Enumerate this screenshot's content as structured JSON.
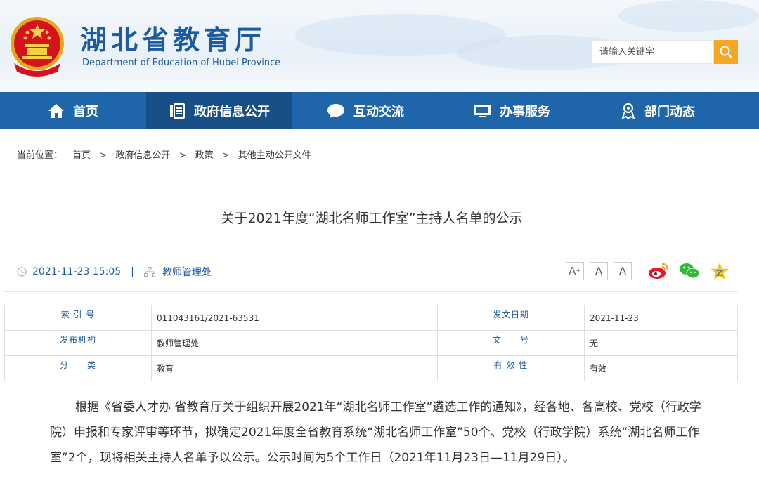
{
  "site": {
    "title": "湖北省教育厅",
    "subtitle": "Department of Education of Hubei Province"
  },
  "search": {
    "placeholder": "请输入关键字"
  },
  "nav": {
    "items": [
      {
        "label": "首页",
        "icon": "home-icon"
      },
      {
        "label": "政府信息公开",
        "icon": "document-list-icon",
        "active": true
      },
      {
        "label": "互动交流",
        "icon": "chat-bubble-icon"
      },
      {
        "label": "办事服务",
        "icon": "monitor-icon"
      },
      {
        "label": "部门动态",
        "icon": "award-person-icon"
      }
    ]
  },
  "breadcrumb": {
    "prefix": "当前位置：",
    "items": [
      "首页",
      "政府信息公开",
      "政策",
      "其他主动公开文件"
    ],
    "separator": ">"
  },
  "article": {
    "title": "关于2021年度“湖北名师工作室”主持人名单的公示",
    "datetime": "2021-11-23 15:05",
    "divider": "|",
    "department": "教师管理处",
    "paragraph": "根据《省委人才办 省教育厅关于组织开展2021年“湖北名师工作室”遴选工作的通知》，经各地、各高校、党校（行政学院）申报和专家评审等环节，拟确定2021年度全省教育系统“湖北名师工作室”50个、党校（行政学院）系统“湖北名师工作室”2个，现将相关主持人名单予以公示。公示时间为5个工作日（2021年11月23日—11月29日）。"
  },
  "font_buttons": [
    "A+",
    "A",
    "A-"
  ],
  "share": {
    "weibo_icon": "weibo-icon",
    "wechat_icon": "wechat-icon",
    "qzone_icon": "qzone-star-icon"
  },
  "info_table": {
    "rows": [
      {
        "k1": "索 引 号",
        "v1": "011043161/2021-63531",
        "k2": "发文日期",
        "v2": "2021-11-23"
      },
      {
        "k1": "发布机构",
        "v1": "教师管理处",
        "k2": "文　　号",
        "v2": "无"
      },
      {
        "k1": "分　　类",
        "v1": "教育",
        "k2": "有 效 性",
        "v2": "有效"
      }
    ]
  },
  "colors": {
    "brand_blue": "#1f65aa",
    "nav_active": "#174f86",
    "search_button": "#f5a623",
    "link_blue": "#1e5aa0"
  }
}
